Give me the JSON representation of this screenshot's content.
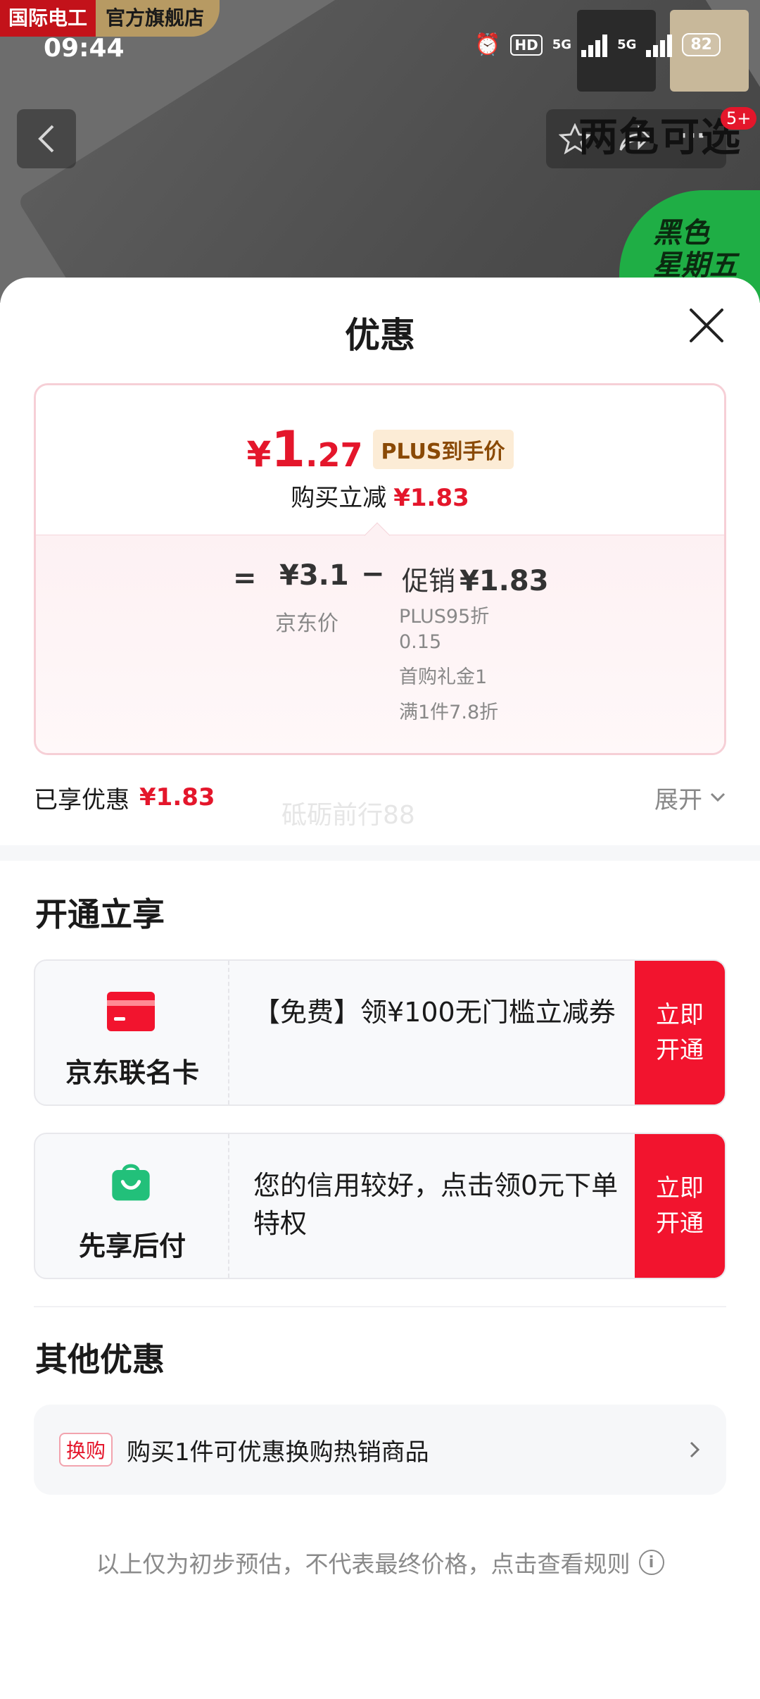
{
  "status_bar": {
    "time": "09:44",
    "hd": "HD",
    "net1": "5G",
    "net2": "5G",
    "battery": "82"
  },
  "store_tag": {
    "brand": "国际电工",
    "suffix": "官方旗舰店"
  },
  "background_promo": {
    "headline": "两色可选",
    "cart_badge": "5+",
    "green_line1": "黑色",
    "green_line2": "星期五"
  },
  "sheet": {
    "title": "优惠",
    "price_card": {
      "currency": "¥",
      "price_int": "1",
      "price_dec": ".27",
      "plus_tag": "PLUS到手价",
      "save_label": "购买立减",
      "save_value": "¥1.83",
      "calc": {
        "equals": "=",
        "jd_price": "¥3.1",
        "minus": "−",
        "promo_label": "促销",
        "promo_value": "¥1.83",
        "jd_price_label": "京东价",
        "details": [
          "PLUS95折",
          "0.15",
          "首购礼金1",
          "满1件7.8折"
        ]
      }
    },
    "enjoyed": {
      "label": "已享优惠",
      "value": "¥1.83",
      "expand": "展开"
    },
    "watermark": "砥砺前行88",
    "open_section": {
      "title": "开通立享",
      "cards": [
        {
          "name": "京东联名卡",
          "desc": "【免费】领¥100无门槛立减券",
          "button": "立即开通",
          "icon": "credit-card-icon",
          "icon_color": "#f2142e"
        },
        {
          "name": "先享后付",
          "desc": "您的信用较好，点击领0元下单特权",
          "button": "立即开通",
          "icon": "shopping-bag-icon",
          "icon_color": "#22c07a"
        }
      ]
    },
    "other_section": {
      "title": "其他优惠",
      "swap_tag": "换购",
      "swap_text": "购买1件可优惠换购热销商品"
    },
    "footnote": "以上仅为初步预估，不代表最终价格，点击查看规则"
  },
  "colors": {
    "accent_red": "#e4162b",
    "button_red": "#f2142e",
    "plus_gold": "#8a4a06",
    "green": "#22c07a"
  }
}
